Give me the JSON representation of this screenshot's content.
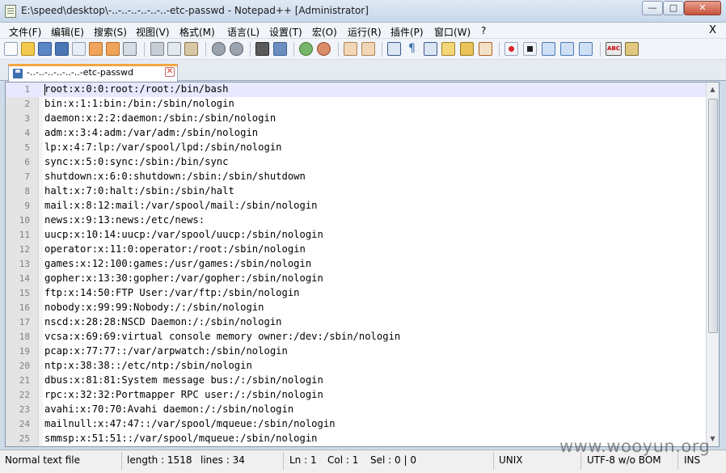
{
  "window": {
    "title": "E:\\speed\\desktop\\-..-..-..-..-..-..-etc-passwd - Notepad++ [Administrator]",
    "min_glyph": "—",
    "max_glyph": "□",
    "close_glyph": "✕"
  },
  "menu": {
    "items": [
      "文件(F)",
      "编辑(E)",
      "搜索(S)",
      "视图(V)",
      "格式(M)",
      "语言(L)",
      "设置(T)",
      "宏(O)",
      "运行(R)",
      "插件(P)",
      "窗口(W)",
      "?"
    ],
    "close_label": "X"
  },
  "toolbar": {
    "icons": [
      "new-file-icon",
      "open-file-icon",
      "save-icon",
      "save-all-icon",
      "close-icon",
      "close-all-icon",
      "print-icon",
      "cut-icon",
      "copy-icon",
      "paste-icon",
      "undo-icon",
      "redo-icon",
      "find-icon",
      "replace-icon",
      "zoom-in-icon",
      "zoom-out-icon",
      "sync-vertical-icon",
      "sync-horizontal-icon",
      "word-wrap-icon",
      "show-all-chars-icon",
      "indent-guide-icon",
      "user-language-icon",
      "document-map-icon",
      "function-list-icon",
      "record-macro-icon",
      "stop-record-icon",
      "play-macro-icon",
      "run-macro-multiple-icon",
      "save-macro-icon",
      "spell-check-icon",
      "spell-auto-icon"
    ]
  },
  "tab": {
    "label": "-..-..-..-..-..-..-etc-passwd",
    "close_glyph": "✕"
  },
  "editor": {
    "current_line": 1,
    "lines": [
      "root:x:0:0:root:/root:/bin/bash",
      "bin:x:1:1:bin:/bin:/sbin/nologin",
      "daemon:x:2:2:daemon:/sbin:/sbin/nologin",
      "adm:x:3:4:adm:/var/adm:/sbin/nologin",
      "lp:x:4:7:lp:/var/spool/lpd:/sbin/nologin",
      "sync:x:5:0:sync:/sbin:/bin/sync",
      "shutdown:x:6:0:shutdown:/sbin:/sbin/shutdown",
      "halt:x:7:0:halt:/sbin:/sbin/halt",
      "mail:x:8:12:mail:/var/spool/mail:/sbin/nologin",
      "news:x:9:13:news:/etc/news:",
      "uucp:x:10:14:uucp:/var/spool/uucp:/sbin/nologin",
      "operator:x:11:0:operator:/root:/sbin/nologin",
      "games:x:12:100:games:/usr/games:/sbin/nologin",
      "gopher:x:13:30:gopher:/var/gopher:/sbin/nologin",
      "ftp:x:14:50:FTP User:/var/ftp:/sbin/nologin",
      "nobody:x:99:99:Nobody:/:/sbin/nologin",
      "nscd:x:28:28:NSCD Daemon:/:/sbin/nologin",
      "vcsa:x:69:69:virtual console memory owner:/dev:/sbin/nologin",
      "pcap:x:77:77::/var/arpwatch:/sbin/nologin",
      "ntp:x:38:38::/etc/ntp:/sbin/nologin",
      "dbus:x:81:81:System message bus:/:/sbin/nologin",
      "rpc:x:32:32:Portmapper RPC user:/:/sbin/nologin",
      "avahi:x:70:70:Avahi daemon:/:/sbin/nologin",
      "mailnull:x:47:47::/var/spool/mqueue:/sbin/nologin",
      "smmsp:x:51:51::/var/spool/mqueue:/sbin/nologin"
    ]
  },
  "status": {
    "file_type": "Normal text file",
    "length": "length : 1518",
    "lines": "lines : 34",
    "ln": "Ln : 1",
    "col": "Col : 1",
    "sel": "Sel : 0 | 0",
    "eol": "UNIX",
    "encoding": "UTF-8 w/o BOM",
    "mode": "INS"
  },
  "watermark": "www.wooyun.org"
}
